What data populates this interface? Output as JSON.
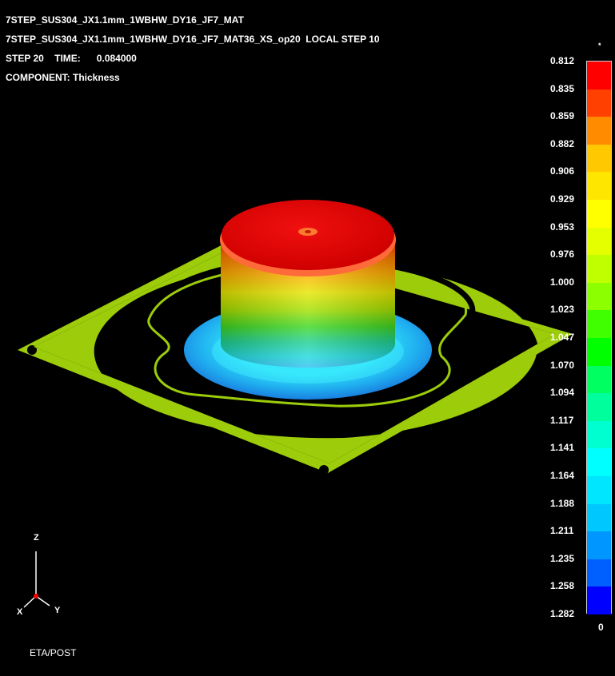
{
  "header": {
    "line1": "7STEP_SUS304_JX1.1mm_1WBHW_DY16_JF7_MAT",
    "line2": "7STEP_SUS304_JX1.1mm_1WBHW_DY16_JF7_MAT36_XS_op20  LOCAL STEP 10",
    "line3": "STEP 20    TIME:      0.084000",
    "line4": "COMPONENT: Thickness"
  },
  "legend": {
    "top_marker": "*",
    "bottom_marker": "0",
    "ticks": [
      "0.812",
      "0.835",
      "0.859",
      "0.882",
      "0.906",
      "0.929",
      "0.953",
      "0.976",
      "1.000",
      "1.023",
      "1.047",
      "1.070",
      "1.094",
      "1.117",
      "1.141",
      "1.164",
      "1.188",
      "1.211",
      "1.235",
      "1.258",
      "1.282"
    ],
    "colors": [
      "#ff0000",
      "#ff4000",
      "#ff8c00",
      "#ffc800",
      "#ffe600",
      "#ffff00",
      "#e6ff00",
      "#c0ff00",
      "#8cff00",
      "#40ff00",
      "#00ff00",
      "#00ff60",
      "#00ff9c",
      "#00ffd0",
      "#00ffff",
      "#00e6ff",
      "#00c8ff",
      "#0096ff",
      "#0060ff",
      "#0000ff"
    ]
  },
  "axes": {
    "z": "Z",
    "x": "X",
    "y": "Y"
  },
  "footer": {
    "label": "ETA/POST"
  },
  "colors": {
    "background": "#000000",
    "sheet": "#9ccc0a",
    "rim": "#d00000"
  }
}
